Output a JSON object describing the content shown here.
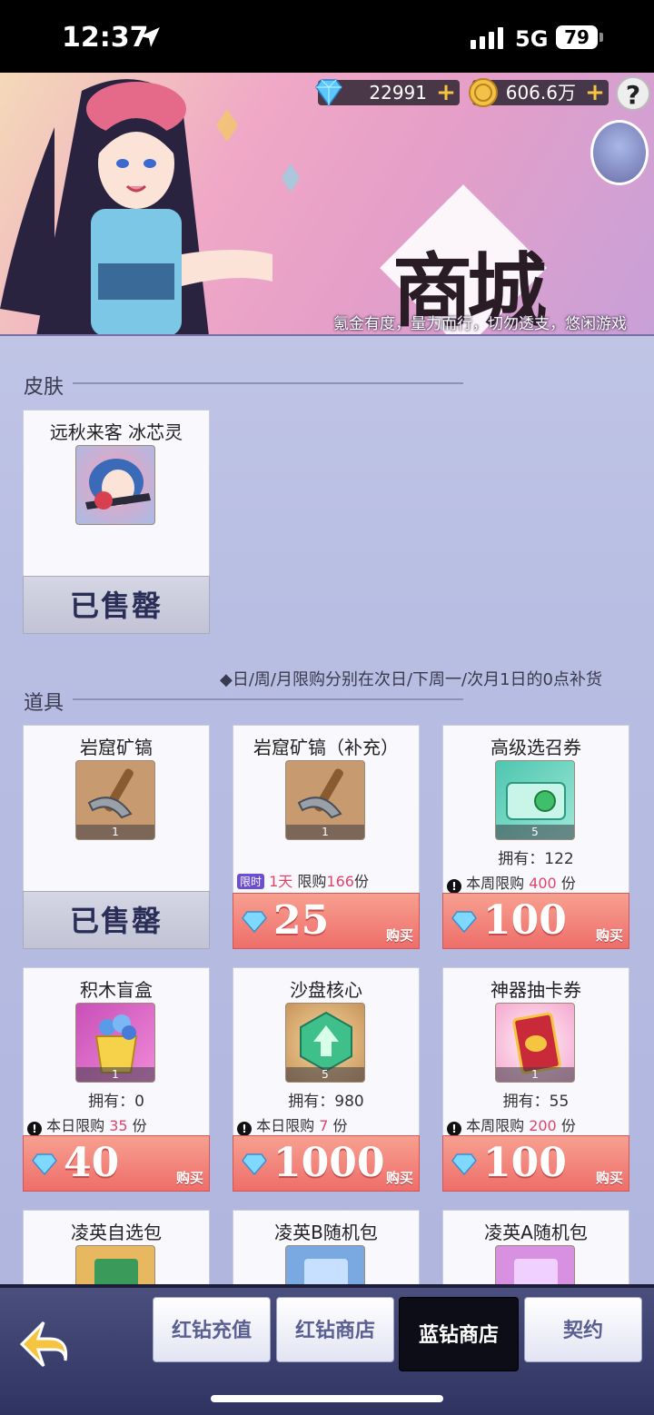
{
  "status_bar": {
    "time": "12:37",
    "network": "5G",
    "battery": "79"
  },
  "header": {
    "diamonds": "22991",
    "gold": "606.6万",
    "help": "?",
    "title": "商城",
    "slogan": "氪金有度，量力而行，切勿透支，悠闲游戏"
  },
  "skins": {
    "section_title": "皮肤",
    "items": [
      {
        "name": "远秋来客 冰芯灵",
        "status": "已售罄"
      }
    ]
  },
  "items_section": {
    "section_title": "道具",
    "note": "◆日/周/月限购分别在次日/下周一/次月1日的0点补货"
  },
  "items": [
    {
      "name": "岩窟矿镐",
      "qty": "1",
      "status": "已售罄"
    },
    {
      "name": "岩窟矿镐（补充）",
      "qty": "1",
      "timed_tag": "限时",
      "timed_day": "1天",
      "limit_text": " 限购",
      "limit_num": "166",
      "limit_unit": "份",
      "price": "25",
      "buy": "购买"
    },
    {
      "name": "高级选召券",
      "qty": "5",
      "owned": "拥有：122",
      "limit_text": " 本周限购 ",
      "limit_num": "400",
      "limit_unit": " 份",
      "price": "100",
      "buy": "购买"
    },
    {
      "name": "积木盲盒",
      "qty": "1",
      "owned": "拥有：0",
      "limit_text": " 本日限购 ",
      "limit_num": "35",
      "limit_unit": " 份",
      "price": "40",
      "buy": "购买"
    },
    {
      "name": "沙盘核心",
      "qty": "5",
      "owned": "拥有：980",
      "limit_text": " 本日限购 ",
      "limit_num": "7",
      "limit_unit": " 份",
      "price": "1000",
      "buy": "购买"
    },
    {
      "name": "神器抽卡券",
      "qty": "1",
      "owned": "拥有：55",
      "limit_text": " 本周限购 ",
      "limit_num": "200",
      "limit_unit": " 份",
      "price": "100",
      "buy": "购买"
    },
    {
      "name": "凌英自选包"
    },
    {
      "name": "凌英B随机包"
    },
    {
      "name": "凌英A随机包"
    }
  ],
  "bottom_nav": {
    "tabs": [
      {
        "label": "红钻充值"
      },
      {
        "label": "红钻商店"
      },
      {
        "label": "蓝钻商店",
        "active": true
      },
      {
        "label": "契约"
      }
    ]
  }
}
